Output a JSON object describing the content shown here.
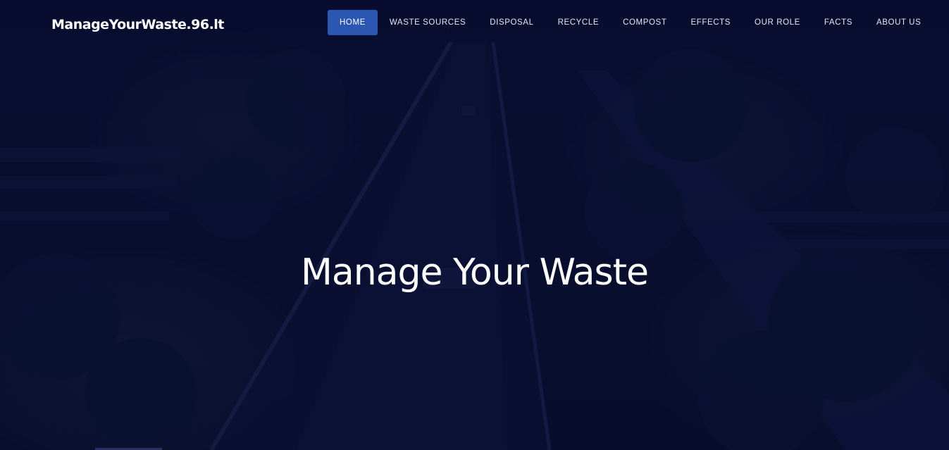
{
  "brand": {
    "title": "ManageYourWaste.96.lt"
  },
  "nav": {
    "items": [
      {
        "label": "HOME",
        "active": true
      },
      {
        "label": "WASTE SOURCES",
        "active": false
      },
      {
        "label": "DISPOSAL",
        "active": false
      },
      {
        "label": "RECYCLE",
        "active": false
      },
      {
        "label": "COMPOST",
        "active": false
      },
      {
        "label": "EFFECTS",
        "active": false
      },
      {
        "label": "OUR ROLE",
        "active": false
      },
      {
        "label": "FACTS",
        "active": false
      },
      {
        "label": "ABOUT US",
        "active": false
      }
    ]
  },
  "hero": {
    "title": "Manage Your Waste"
  },
  "colors": {
    "background": "#0a1030",
    "nav_active": "#2b56b2",
    "text": "#ffffff"
  }
}
